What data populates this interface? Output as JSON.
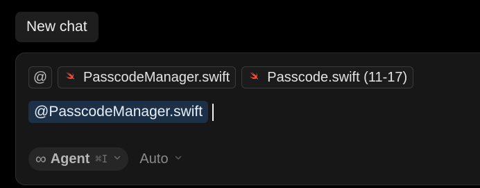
{
  "header": {
    "tab_label": "New chat"
  },
  "composer": {
    "at_label": "@",
    "context_chips": [
      {
        "label": "PasscodeManager.swift",
        "icon": "swift-icon"
      },
      {
        "label": "Passcode.swift (11-17)",
        "icon": "swift-icon"
      }
    ],
    "mention_text": "@PasscodeManager.swift",
    "mode": {
      "icon": "infinity-icon",
      "icon_glyph": "∞",
      "label": "Agent",
      "shortcut": "⌘I"
    },
    "model": {
      "label": "Auto"
    }
  },
  "colors": {
    "background": "#000000",
    "composer_background": "#171717",
    "mention_highlight": "#1c3148",
    "swift_orange": "#f05138"
  }
}
